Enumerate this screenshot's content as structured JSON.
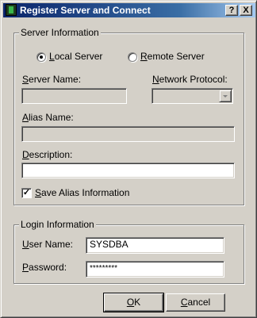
{
  "window": {
    "title": "Register Server and Connect",
    "help_button": "?",
    "close_button": "X"
  },
  "server_info": {
    "group_label": "Server Information",
    "local_server": {
      "prefix": "",
      "mnemonic": "L",
      "rest": "ocal Server",
      "checked": true
    },
    "remote_server": {
      "prefix": "",
      "mnemonic": "R",
      "rest": "emote Server",
      "checked": false
    },
    "server_name": {
      "prefix": "",
      "mnemonic": "S",
      "rest": "erver Name:",
      "value": ""
    },
    "network_protocol": {
      "prefix": "",
      "mnemonic": "N",
      "rest": "etwork Protocol:",
      "value": ""
    },
    "alias_name": {
      "prefix": "",
      "mnemonic": "A",
      "rest": "lias Name:",
      "value": ""
    },
    "description": {
      "prefix": "",
      "mnemonic": "D",
      "rest": "escription:",
      "value": ""
    },
    "save_alias": {
      "prefix": "",
      "mnemonic": "S",
      "rest": "ave Alias Information",
      "checked": true,
      "check_glyph": "✓"
    }
  },
  "login_info": {
    "group_label": "Login Information",
    "user_name": {
      "prefix": "",
      "mnemonic": "U",
      "rest": "ser Name:",
      "value": "SYSDBA"
    },
    "password": {
      "prefix": "",
      "mnemonic": "P",
      "rest": "assword:",
      "value": "*********"
    }
  },
  "buttons": {
    "ok": {
      "mnemonic": "O",
      "rest": "K"
    },
    "cancel": {
      "mnemonic": "C",
      "rest": "ancel"
    }
  },
  "colors": {
    "face": "#d4d0c8",
    "title_gradient_start": "#0a246a",
    "title_gradient_end": "#a6caf0"
  }
}
